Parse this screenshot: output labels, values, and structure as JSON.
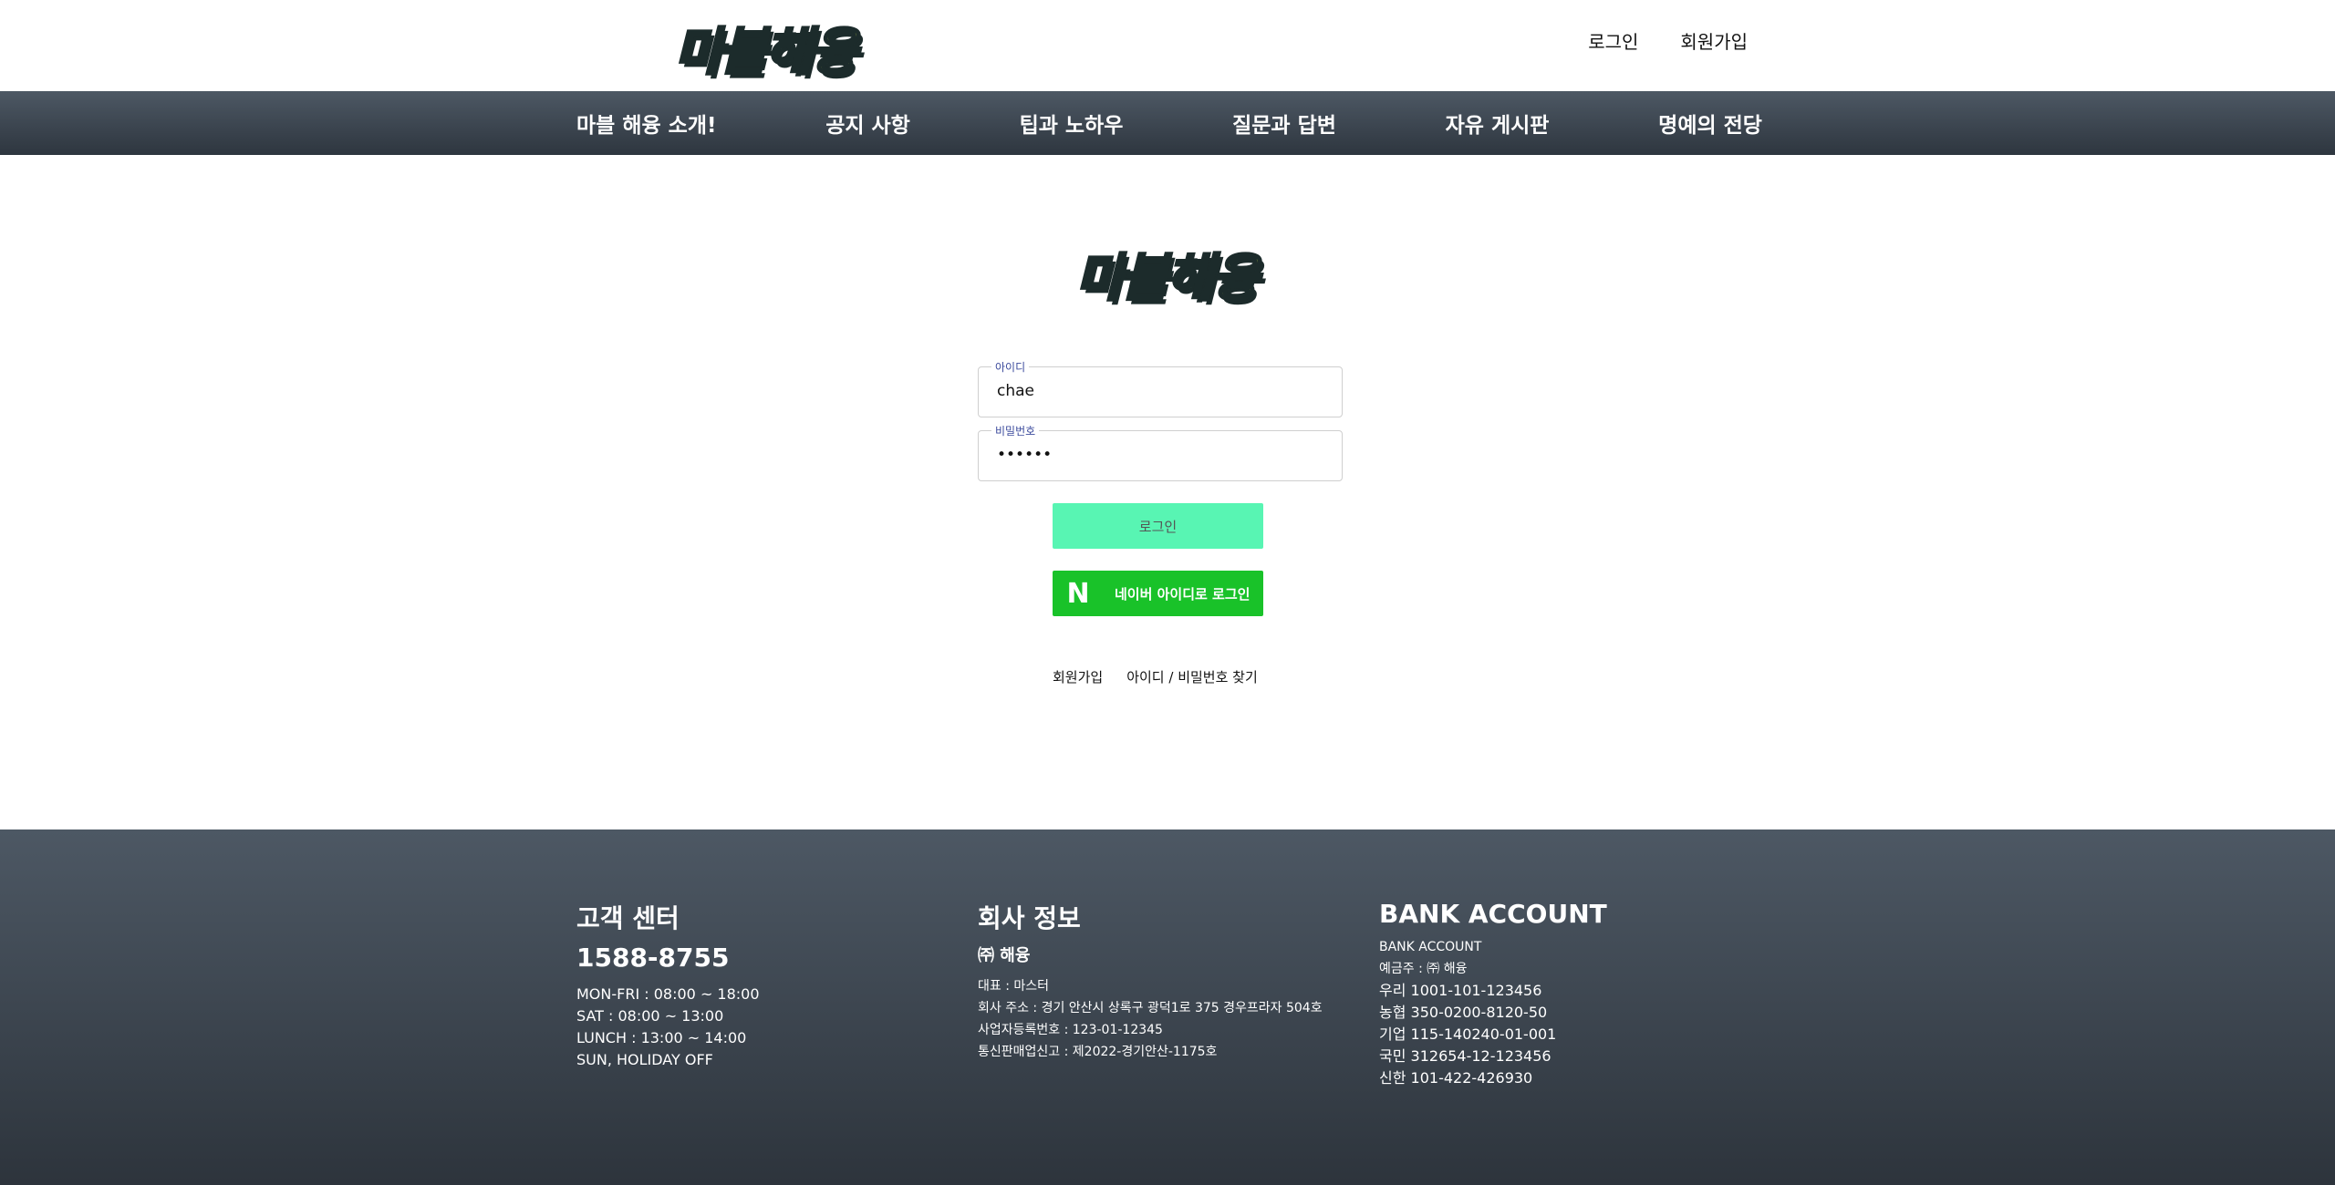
{
  "header": {
    "logo_part1": "마블",
    "logo_part2": "해융",
    "links": {
      "login": "로그인",
      "signup": "회원가입"
    }
  },
  "nav": {
    "items": [
      "마블 해융 소개!",
      "공지 사항",
      "팁과 노하우",
      "질문과 답변",
      "자유 게시판",
      "명예의 전당"
    ]
  },
  "login": {
    "logo_part1": "마블",
    "logo_part2": "해융",
    "id_label": "아이디",
    "id_value": "chae",
    "pw_label": "비밀번호",
    "pw_value": "••••••",
    "login_button": "로그인",
    "naver_icon": "naver-n-icon",
    "naver_button": "네이버 아이디로 로그인",
    "signup_link": "회원가입",
    "find_link": "아이디 / 비밀번호 찾기"
  },
  "footer": {
    "customer": {
      "title": "고객 센터",
      "phone": "1588-8755",
      "hours": [
        "MON-FRI : 08:00 ~ 18:00",
        "SAT : 08:00 ~ 13:00",
        "LUNCH : 13:00 ~ 14:00",
        "SUN, HOLIDAY OFF"
      ]
    },
    "company": {
      "title": "회사 정보",
      "name": "㈜ 해융",
      "lines": [
        "대표 : 마스터",
        "회사 주소 : 경기 안산시 상록구 광덕1로 375 경우프라자 504호",
        "사업자등록번호 : 123-01-12345",
        "통신판매업신고 : 제2022-경기안산-1175호"
      ]
    },
    "bank": {
      "title": "BANK ACCOUNT",
      "subtitle": "BANK ACCOUNT",
      "lines": [
        "예금주 : ㈜ 해융",
        "우리 1001-101-123456",
        "농협 350-0200-8120-50",
        "기업 115-140240-01-001",
        "국민 312654-12-123456",
        "신한 101-422-426930"
      ]
    }
  },
  "colors": {
    "nav_bg_top": "#4d5864",
    "nav_bg_bottom": "#2e363f",
    "login_button": "#58f5b3",
    "naver_green": "#19c229",
    "logo_mint": "#2ee6c4",
    "logo_lime": "#c6e04a"
  }
}
